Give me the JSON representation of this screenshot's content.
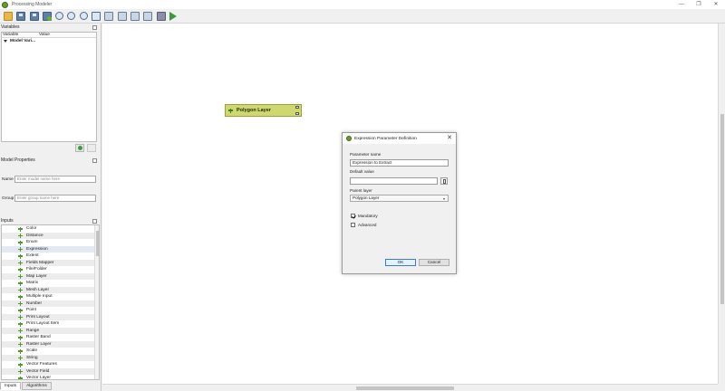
{
  "window": {
    "title": "Processing Modeler",
    "minimize": "—",
    "restore": "❐",
    "close": "✕"
  },
  "toolbar": {
    "icons": [
      "open-model-icon",
      "save-model-icon",
      "save-model-as-icon",
      "save-to-project-icon",
      "zoom-in-icon",
      "zoom-out-icon",
      "zoom-actual-icon",
      "zoom-full-icon",
      "export-image-icon",
      "export-pdf-icon",
      "export-svg-icon",
      "export-python-icon",
      "help-icon",
      "run-model-icon"
    ]
  },
  "variables": {
    "title": "Variables",
    "col_variable": "Variable",
    "col_value": "Value",
    "group": "Model Vari..."
  },
  "model_properties": {
    "title": "Model Properties",
    "name_label": "Name",
    "name_placeholder": "Enter model name here",
    "group_label": "Group",
    "group_placeholder": "Enter group name here"
  },
  "inputs": {
    "title": "Inputs",
    "items": [
      "Color",
      "Distance",
      "Enum",
      "Expression",
      "Extent",
      "Fields Mapper",
      "File/Folder",
      "Map Layer",
      "Matrix",
      "Mesh Layer",
      "Multiple Input",
      "Number",
      "Point",
      "Print Layout",
      "Print Layout Item",
      "Range",
      "Raster Band",
      "Raster Layer",
      "Scale",
      "String",
      "Vector Features",
      "Vector Field",
      "Vector Layer"
    ]
  },
  "tabs": {
    "inputs": "Inputs",
    "algorithms": "Algorithms"
  },
  "canvas": {
    "node_label": "Polygon Layer"
  },
  "dialog": {
    "title": "Expression Parameter Definition",
    "close": "✕",
    "param_name_label": "Parameter name",
    "param_name_value": "Expression to Extract",
    "default_value_label": "Default value",
    "default_value": "",
    "parent_layer_label": "Parent layer",
    "parent_layer_value": "Polygon Layer",
    "mandatory_label": "Mandatory",
    "advanced_label": "Advanced",
    "ok_label": "OK",
    "cancel_label": "Cancel"
  }
}
